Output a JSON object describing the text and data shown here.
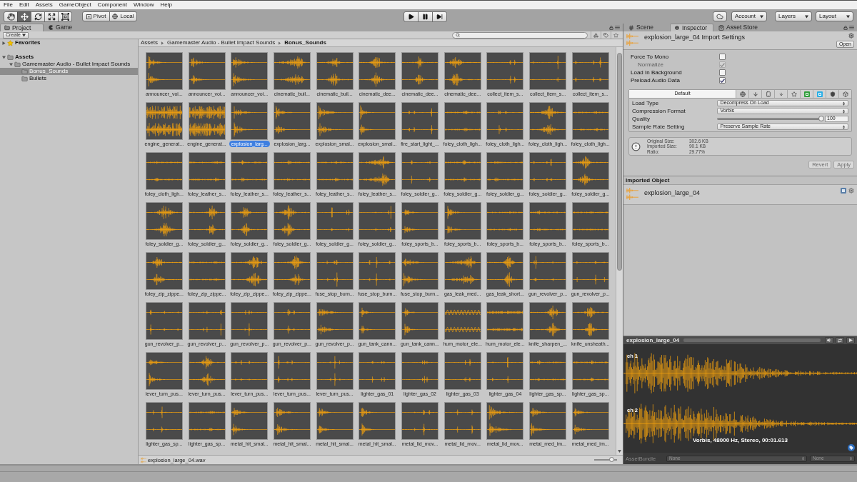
{
  "menu_bar": [
    "File",
    "Edit",
    "Assets",
    "GameObject",
    "Component",
    "Window",
    "Help"
  ],
  "toolbar": {
    "tools": [
      {
        "kind": "hand",
        "selected": false
      },
      {
        "kind": "move",
        "selected": true
      },
      {
        "kind": "rotate",
        "selected": false
      },
      {
        "kind": "scale",
        "selected": false
      },
      {
        "kind": "rect",
        "selected": false
      }
    ],
    "handle_buttons": [
      {
        "kind": "pivot",
        "label": "Pivot"
      },
      {
        "kind": "local",
        "label": "Local"
      }
    ],
    "account": "Account",
    "layers": "Layers",
    "layout": "Layout"
  },
  "left_tabs": [
    {
      "kind": "project",
      "label": "Project",
      "selected": true
    },
    {
      "kind": "game",
      "label": "Game",
      "selected": false
    }
  ],
  "project": {
    "create": "Create",
    "tree": [
      {
        "kind": "favorites",
        "label": "Favorites",
        "expanded": false,
        "selected": false
      },
      {
        "kind": "folder",
        "label": "Assets",
        "expanded": true,
        "selected": false,
        "children": [
          {
            "kind": "folder",
            "label": "Gamemaster Audio - Bullet Impact Sounds",
            "expanded": true,
            "selected": false,
            "children": [
              {
                "kind": "folder",
                "label": "Bonus_Sounds",
                "selected": true
              },
              {
                "kind": "folder",
                "label": "Bullets",
                "selected": false
              }
            ]
          }
        ]
      }
    ],
    "breadcrumb": [
      "Assets",
      "Gamemaster Audio - Bullet Impact Sounds",
      "Bonus_Sounds"
    ],
    "assets": [
      {
        "name": "announcer_voi...",
        "kind": "decay",
        "selected": false
      },
      {
        "name": "announcer_voi...",
        "kind": "decay",
        "selected": false
      },
      {
        "name": "announcer_voi...",
        "kind": "decay",
        "selected": false
      },
      {
        "name": "cinematic_buil...",
        "kind": "swell",
        "selected": false
      },
      {
        "name": "cinematic_buil...",
        "kind": "burst",
        "selected": false
      },
      {
        "name": "cinematic_dee...",
        "kind": "burst",
        "selected": false
      },
      {
        "name": "cinematic_dee...",
        "kind": "burst",
        "selected": false
      },
      {
        "name": "cinematic_dee...",
        "kind": "burst",
        "selected": false
      },
      {
        "name": "collect_item_s...",
        "kind": "spike",
        "selected": false
      },
      {
        "name": "collect_item_s...",
        "kind": "spike",
        "selected": false
      },
      {
        "name": "collect_item_s...",
        "kind": "spike",
        "selected": false
      },
      {
        "name": "engine_generat...",
        "kind": "noise",
        "selected": false
      },
      {
        "name": "engine_generat...",
        "kind": "noise",
        "selected": false
      },
      {
        "name": "explosion_larg...",
        "kind": "decay",
        "selected": true
      },
      {
        "name": "explosion_larg...",
        "kind": "decay",
        "selected": false
      },
      {
        "name": "explosion_smal...",
        "kind": "decay",
        "selected": false
      },
      {
        "name": "explosion_smal...",
        "kind": "decay",
        "selected": false
      },
      {
        "name": "fire_start_light_...",
        "kind": "spike",
        "selected": false
      },
      {
        "name": "foley_cloth_ligh...",
        "kind": "faint",
        "selected": false
      },
      {
        "name": "foley_cloth_ligh...",
        "kind": "spike",
        "selected": false
      },
      {
        "name": "foley_cloth_ligh...",
        "kind": "burst",
        "selected": false
      },
      {
        "name": "foley_cloth_ligh...",
        "kind": "faint",
        "selected": false
      },
      {
        "name": "foley_cloth_ligh...",
        "kind": "faint",
        "selected": false
      },
      {
        "name": "foley_leather_s...",
        "kind": "faint",
        "selected": false
      },
      {
        "name": "foley_leather_s...",
        "kind": "faint",
        "selected": false
      },
      {
        "name": "foley_leather_s...",
        "kind": "faint",
        "selected": false
      },
      {
        "name": "foley_leather_s...",
        "kind": "faint",
        "selected": false
      },
      {
        "name": "foley_leather_s...",
        "kind": "swell",
        "selected": false
      },
      {
        "name": "foley_soldier_g...",
        "kind": "spike",
        "selected": false
      },
      {
        "name": "foley_soldier_g...",
        "kind": "faint",
        "selected": false
      },
      {
        "name": "foley_soldier_g...",
        "kind": "faint",
        "selected": false
      },
      {
        "name": "foley_soldier_g...",
        "kind": "spike",
        "selected": false
      },
      {
        "name": "foley_soldier_g...",
        "kind": "burst",
        "selected": false
      },
      {
        "name": "foley_soldier_g...",
        "kind": "burst",
        "selected": false
      },
      {
        "name": "foley_soldier_g...",
        "kind": "burst",
        "selected": false
      },
      {
        "name": "foley_soldier_g...",
        "kind": "burst",
        "selected": false
      },
      {
        "name": "foley_soldier_g...",
        "kind": "burst",
        "selected": false
      },
      {
        "name": "foley_soldier_g...",
        "kind": "spike",
        "selected": false
      },
      {
        "name": "foley_soldier_g...",
        "kind": "spike",
        "selected": false
      },
      {
        "name": "foley_sports_b...",
        "kind": "decay",
        "selected": false
      },
      {
        "name": "foley_sports_b...",
        "kind": "decay",
        "selected": false
      },
      {
        "name": "foley_sports_b...",
        "kind": "faint",
        "selected": false
      },
      {
        "name": "foley_sports_b...",
        "kind": "faint",
        "selected": false
      },
      {
        "name": "foley_sports_b...",
        "kind": "faint",
        "selected": false
      },
      {
        "name": "foley_zip_zippe...",
        "kind": "burst",
        "selected": false
      },
      {
        "name": "foley_zip_zippe...",
        "kind": "faint",
        "selected": false
      },
      {
        "name": "foley_zip_zippe...",
        "kind": "burst",
        "selected": false
      },
      {
        "name": "foley_zip_zippe...",
        "kind": "burst",
        "selected": false
      },
      {
        "name": "fuse_stop_burn...",
        "kind": "spike",
        "selected": false
      },
      {
        "name": "fuse_stop_burn...",
        "kind": "spike",
        "selected": false
      },
      {
        "name": "fuse_stop_burn...",
        "kind": "decay",
        "selected": false
      },
      {
        "name": "gas_leak_med...",
        "kind": "swell",
        "selected": false
      },
      {
        "name": "gas_leak_short...",
        "kind": "burst",
        "selected": false
      },
      {
        "name": "gun_revolver_p...",
        "kind": "spike",
        "selected": false
      },
      {
        "name": "gun_revolver_p...",
        "kind": "spike",
        "selected": false
      },
      {
        "name": "gun_revolver_p...",
        "kind": "spike",
        "selected": false
      },
      {
        "name": "gun_revolver_p...",
        "kind": "spike",
        "selected": false
      },
      {
        "name": "gun_revolver_p...",
        "kind": "spike",
        "selected": false
      },
      {
        "name": "gun_revolver_p...",
        "kind": "spike",
        "selected": false
      },
      {
        "name": "gun_revolver_p...",
        "kind": "decay",
        "selected": false
      },
      {
        "name": "gun_tank_cann...",
        "kind": "decay",
        "selected": false
      },
      {
        "name": "gun_tank_cann...",
        "kind": "decay",
        "selected": false
      },
      {
        "name": "hum_motor_ele...",
        "kind": "sine",
        "selected": false
      },
      {
        "name": "hum_motor_ele...",
        "kind": "hum",
        "selected": false
      },
      {
        "name": "knife_sharpen_...",
        "kind": "burst",
        "selected": false
      },
      {
        "name": "knife_unsheath...",
        "kind": "burst",
        "selected": false
      },
      {
        "name": "lever_turn_pus...",
        "kind": "decay",
        "selected": false
      },
      {
        "name": "lever_turn_pus...",
        "kind": "burst",
        "selected": false
      },
      {
        "name": "lever_turn_pus...",
        "kind": "spike",
        "selected": false
      },
      {
        "name": "lever_turn_pus...",
        "kind": "spike",
        "selected": false
      },
      {
        "name": "lever_turn_pus...",
        "kind": "spike",
        "selected": false
      },
      {
        "name": "lighter_gas_01",
        "kind": "spike",
        "selected": false
      },
      {
        "name": "lighter_gas_02",
        "kind": "spike",
        "selected": false
      },
      {
        "name": "lighter_gas_03",
        "kind": "spike",
        "selected": false
      },
      {
        "name": "lighter_gas_04",
        "kind": "spike",
        "selected": false
      },
      {
        "name": "lighter_gas_sp...",
        "kind": "faint",
        "selected": false
      },
      {
        "name": "lighter_gas_sp...",
        "kind": "faint",
        "selected": false
      },
      {
        "name": "lighter_gas_sp...",
        "kind": "spike",
        "selected": false
      },
      {
        "name": "lighter_gas_sp...",
        "kind": "faint",
        "selected": false
      },
      {
        "name": "metal_hit_smal...",
        "kind": "decay",
        "selected": false
      },
      {
        "name": "metal_hit_smal...",
        "kind": "decay",
        "selected": false
      },
      {
        "name": "metal_hit_smal...",
        "kind": "decay",
        "selected": false
      },
      {
        "name": "metal_hit_smal...",
        "kind": "decay",
        "selected": false
      },
      {
        "name": "metal_lid_mov...",
        "kind": "spike",
        "selected": false
      },
      {
        "name": "metal_lid_mov...",
        "kind": "spike",
        "selected": false
      },
      {
        "name": "metal_lid_mov...",
        "kind": "decay",
        "selected": false
      },
      {
        "name": "metal_med_im...",
        "kind": "decay",
        "selected": false
      },
      {
        "name": "metal_med_im...",
        "kind": "decay",
        "selected": false
      }
    ],
    "footer_file": "explosion_large_04.wav",
    "size_slider": {
      "level": 0.75
    }
  },
  "right_tabs": [
    {
      "kind": "scene",
      "label": "Scene",
      "selected": false
    },
    {
      "kind": "inspector",
      "label": "Inspector",
      "selected": true
    },
    {
      "kind": "store",
      "label": "Asset Store",
      "selected": false
    }
  ],
  "inspector": {
    "title": "explosion_large_04 Import Settings",
    "open_button": "Open",
    "options": [
      {
        "label": "Force To Mono",
        "checked": false,
        "disabled": false,
        "children": [
          {
            "label": "Normalize",
            "checked": true,
            "disabled": true
          }
        ]
      },
      {
        "label": "Load In Background",
        "checked": false,
        "disabled": false
      },
      {
        "label": "Preload Audio Data",
        "checked": true,
        "disabled": false
      }
    ],
    "platforms": [
      {
        "kind": "default",
        "label": "Default",
        "selected": true
      },
      {
        "kind": "globe",
        "selected": false
      },
      {
        "kind": "down-arrow",
        "selected": false
      },
      {
        "kind": "phone",
        "selected": false
      },
      {
        "kind": "small-arrow",
        "selected": false
      },
      {
        "kind": "star",
        "selected": false
      },
      {
        "kind": "green-tile",
        "selected": false
      },
      {
        "kind": "blue-tile",
        "selected": false
      },
      {
        "kind": "shield",
        "selected": false
      },
      {
        "kind": "cube",
        "selected": false
      }
    ],
    "settings": [
      {
        "kind": "dropdown",
        "label": "Load Type",
        "value": "Decompress On Load"
      },
      {
        "kind": "dropdown",
        "label": "Compression Format",
        "value": "Vorbis"
      },
      {
        "kind": "slider",
        "label": "Quality",
        "level": 1,
        "value": "100"
      },
      {
        "kind": "dropdown",
        "label": "Sample Rate Setting",
        "value": "Preserve Sample Rate"
      }
    ],
    "size_info": [
      {
        "label": "Original Size:",
        "value": "302.6 KB"
      },
      {
        "label": "Imported Size:",
        "value": "90.1 KB"
      },
      {
        "label": "Ratio:",
        "value": "29.77%"
      }
    ],
    "buttons": [
      {
        "label": "Revert",
        "disabled": true
      },
      {
        "label": "Apply",
        "disabled": true
      }
    ],
    "imported_object": {
      "header": "Imported Object",
      "name": "explosion_large_04"
    }
  },
  "preview": {
    "title": "explosion_large_04",
    "channels": [
      "ch 1",
      "ch 2"
    ],
    "info": "Vorbis, 48000 Hz, Stereo, 00:01.613",
    "asset_bundle": {
      "label": "AssetBundle",
      "values": [
        "None",
        "None"
      ]
    }
  }
}
